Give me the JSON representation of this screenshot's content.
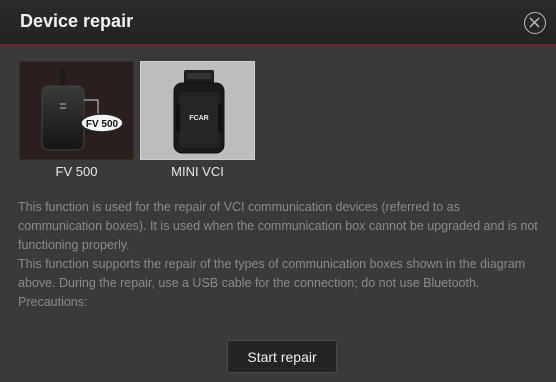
{
  "dialog": {
    "title": "Device repair",
    "close_icon": "close-circle-icon"
  },
  "devices": [
    {
      "label": "FV 500",
      "badge": "FV 500"
    },
    {
      "label": "MINI VCI",
      "logo": "FCAR"
    }
  ],
  "description": {
    "lines": [
      "This function is used for the repair of VCI communication devices (referred to as communication boxes). It is used when the communication box cannot be upgraded and is not functioning properly.",
      "This function supports the repair of the types of communication boxes shown in the diagram above. During the repair, use a USB cable for the connection; do not use Bluetooth.",
      "Precautions:"
    ]
  },
  "actions": {
    "start_label": "Start repair"
  },
  "colors": {
    "title_divider": "#6b2a2a",
    "dialog_bg": "#3a3a3a",
    "text_muted": "#8a8a8a"
  }
}
